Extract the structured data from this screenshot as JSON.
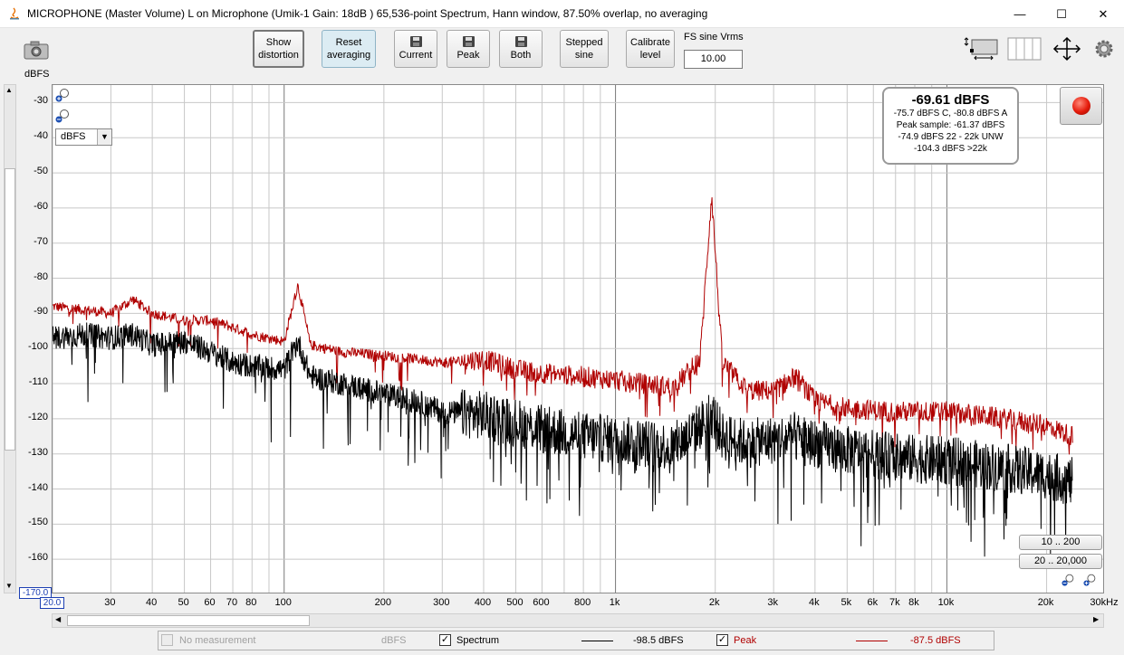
{
  "window": {
    "title": "MICROPHONE (Master Volume) L on Microphone (Umik-1  Gain: 18dB  ) 65,536-point Spectrum, Hann window, 87.50% overlap, no averaging",
    "minimize": "—",
    "maximize": "☐",
    "close": "✕"
  },
  "toolbar": {
    "show_distortion": [
      "Show",
      "distortion"
    ],
    "reset_averaging": [
      "Reset",
      "averaging"
    ],
    "current": "Current",
    "peak": "Peak",
    "both": "Both",
    "stepped_sine": [
      "Stepped",
      "sine"
    ],
    "calibrate_level": [
      "Calibrate",
      "level"
    ],
    "fs_label": "FS sine Vrms",
    "fs_value": "10.00"
  },
  "plot": {
    "y_unit_label": "dBFS",
    "unit_selector": "dBFS",
    "y_ticks": [
      "-30",
      "-40",
      "-50",
      "-60",
      "-70",
      "-80",
      "-90",
      "-100",
      "-110",
      "-120",
      "-130",
      "-140",
      "-150",
      "-160"
    ],
    "y_min_value": "-170.0",
    "x_min_value": "20.0",
    "x_ticks": [
      {
        "f": 30,
        "label": "30"
      },
      {
        "f": 40,
        "label": "40"
      },
      {
        "f": 50,
        "label": "50"
      },
      {
        "f": 60,
        "label": "60"
      },
      {
        "f": 70,
        "label": "70"
      },
      {
        "f": 80,
        "label": "80"
      },
      {
        "f": 100,
        "label": "100"
      },
      {
        "f": 200,
        "label": "200"
      },
      {
        "f": 300,
        "label": "300"
      },
      {
        "f": 400,
        "label": "400"
      },
      {
        "f": 500,
        "label": "500"
      },
      {
        "f": 600,
        "label": "600"
      },
      {
        "f": 800,
        "label": "800"
      },
      {
        "f": 1000,
        "label": "1k"
      },
      {
        "f": 2000,
        "label": "2k"
      },
      {
        "f": 3000,
        "label": "3k"
      },
      {
        "f": 4000,
        "label": "4k"
      },
      {
        "f": 5000,
        "label": "5k"
      },
      {
        "f": 6000,
        "label": "6k"
      },
      {
        "f": 7000,
        "label": "7k"
      },
      {
        "f": 8000,
        "label": "8k"
      },
      {
        "f": 10000,
        "label": "10k"
      },
      {
        "f": 20000,
        "label": "20k"
      },
      {
        "f": 30000,
        "label": "30kHz"
      }
    ],
    "range_button_1": "10 .. 200",
    "range_button_2": "20 .. 20,000"
  },
  "info": {
    "main": "-69.61 dBFS",
    "line1": "-75.7 dBFS C, -80.8 dBFS A",
    "line2": "Peak sample: -61.37 dBFS",
    "line3": "-74.9 dBFS 22 - 22k UNW",
    "line4": "-104.3 dBFS >22k"
  },
  "legend": {
    "none_label": "No measurement",
    "none_unit": "dBFS",
    "spectrum_label": "Spectrum",
    "spectrum_value": "-98.5 dBFS",
    "peak_label": "Peak",
    "peak_value": "-87.5 dBFS",
    "check": "✓"
  },
  "chart_data": {
    "type": "line",
    "x_scale": "log",
    "xlim": [
      20,
      30000
    ],
    "ylim": [
      -170,
      -25
    ],
    "ylabel": "dBFS",
    "colors": {
      "spectrum": "#000000",
      "peak": "#b00000"
    },
    "series": [
      {
        "name": "Spectrum",
        "x": [
          20,
          25,
          30,
          35,
          40,
          50,
          60,
          70,
          80,
          100,
          110,
          120,
          150,
          200,
          250,
          300,
          400,
          500,
          600,
          800,
          1000,
          1500,
          1800,
          1950,
          2100,
          2500,
          3000,
          3500,
          4000,
          5000,
          7000,
          10000,
          15000,
          20000,
          24000
        ],
        "y": [
          -97,
          -96,
          -97,
          -96,
          -99,
          -98,
          -101,
          -104,
          -105,
          -106,
          -98,
          -108,
          -110,
          -113,
          -115,
          -118,
          -119,
          -121,
          -123,
          -125,
          -126,
          -128,
          -122,
          -118,
          -125,
          -127,
          -126,
          -125,
          -127,
          -129,
          -131,
          -132,
          -134,
          -136,
          -138
        ]
      },
      {
        "name": "Peak",
        "x": [
          20,
          25,
          30,
          35,
          40,
          50,
          60,
          70,
          80,
          100,
          110,
          120,
          150,
          200,
          250,
          300,
          400,
          500,
          600,
          800,
          1000,
          1500,
          1800,
          1950,
          2100,
          2500,
          3000,
          3500,
          4000,
          5000,
          7000,
          10000,
          15000,
          20000,
          24000
        ],
        "y": [
          -88,
          -89,
          -90,
          -86,
          -90,
          -92,
          -92,
          -94,
          -96,
          -98,
          -82,
          -99,
          -101,
          -102,
          -103,
          -104,
          -103,
          -106,
          -107,
          -108,
          -109,
          -111,
          -103,
          -56,
          -104,
          -112,
          -112,
          -108,
          -115,
          -117,
          -118,
          -118,
          -120,
          -122,
          -125
        ]
      }
    ]
  }
}
